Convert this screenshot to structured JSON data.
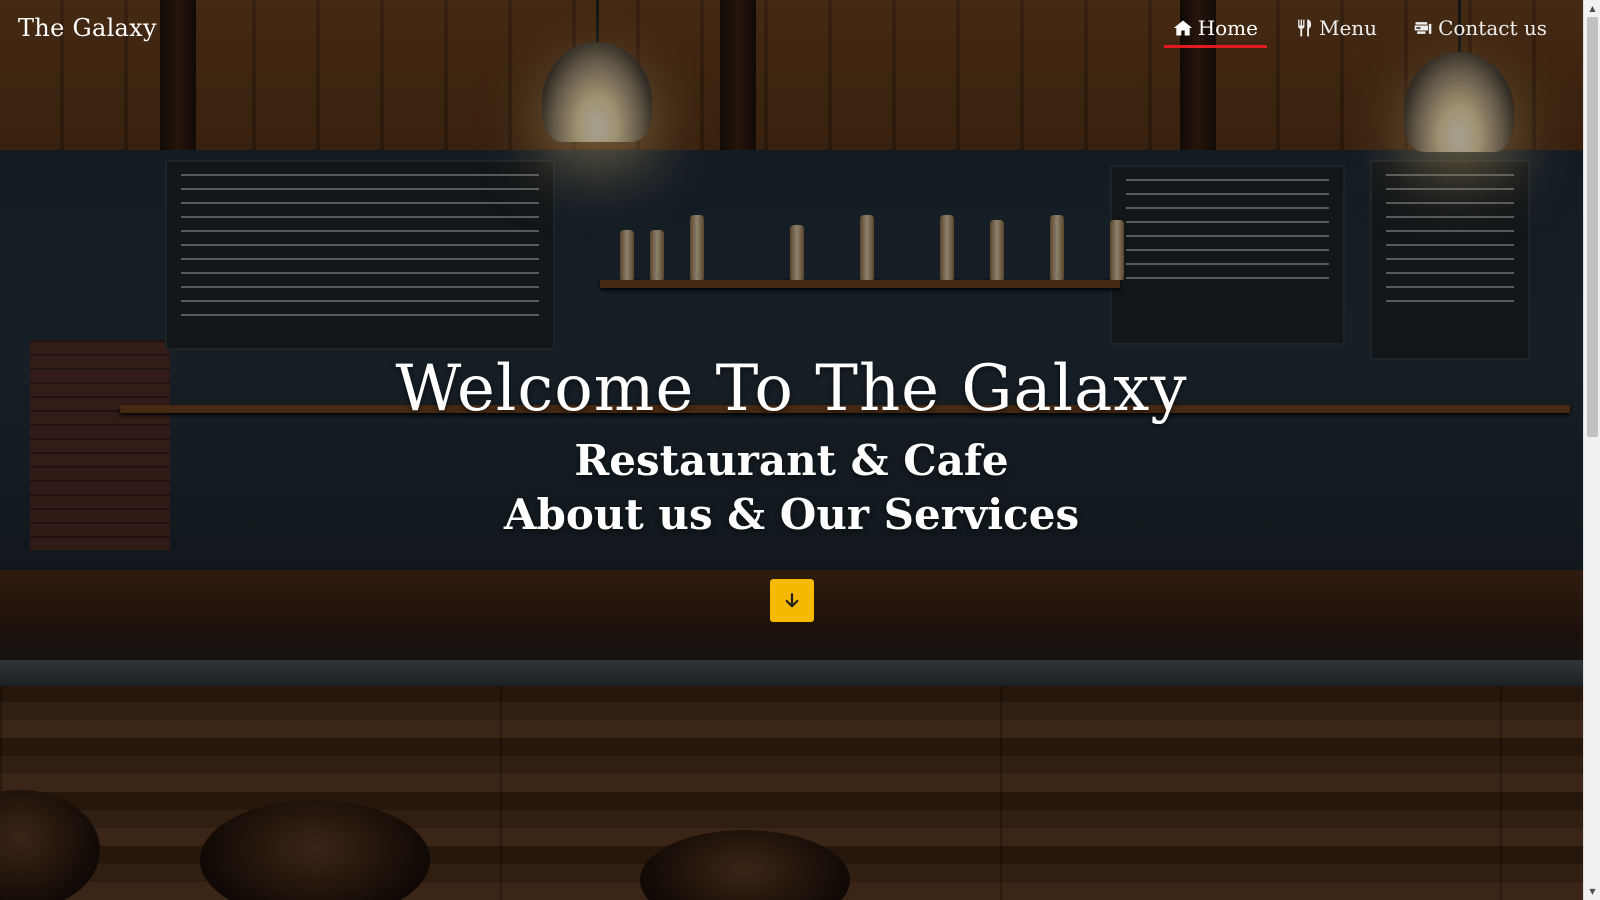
{
  "brand": {
    "name": "The Galaxy"
  },
  "nav": {
    "items": [
      {
        "label": "Home",
        "icon": "home-icon",
        "active": true
      },
      {
        "label": "Menu",
        "icon": "utensils-icon",
        "active": false
      },
      {
        "label": "Contact us",
        "icon": "contact-card-icon",
        "active": false
      }
    ]
  },
  "hero": {
    "title": "Welcome To The Galaxy",
    "subtitle": "Restaurant & Cafe",
    "tagline": "About us & Our Services",
    "scroll_button_icon": "arrow-down-icon"
  },
  "colors": {
    "accent": "#f7b800",
    "active_underline": "#e21b23",
    "text": "#ffffff"
  }
}
